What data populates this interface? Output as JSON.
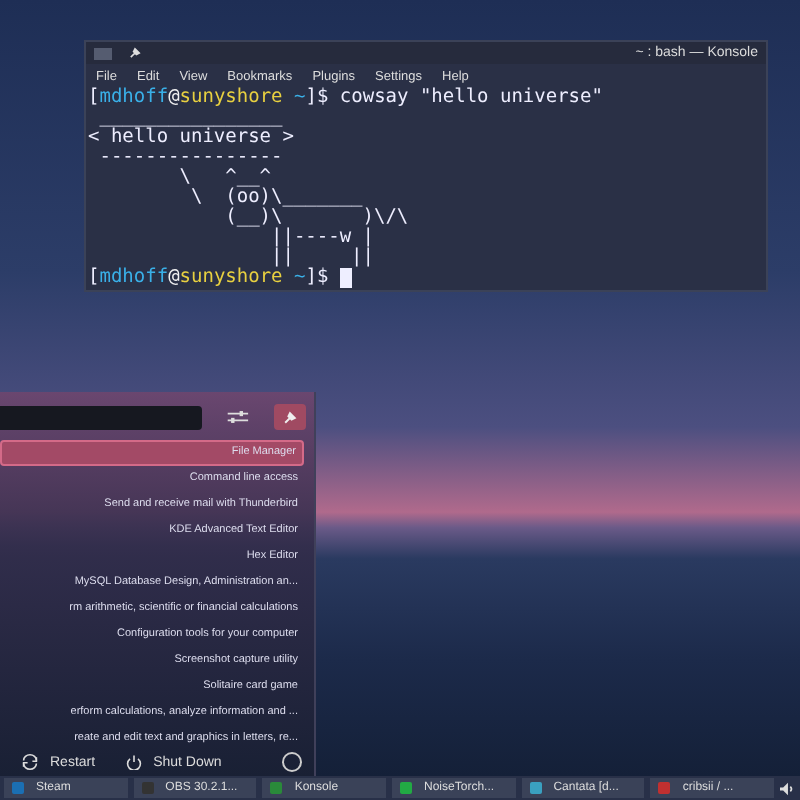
{
  "konsole": {
    "title": "~ : bash — Konsole",
    "menu": [
      "File",
      "Edit",
      "View",
      "Bookmarks",
      "Plugins",
      "Settings",
      "Help"
    ],
    "lines": [
      {
        "kind": "prompt",
        "open": "[",
        "user": "mdhoff",
        "at": "@",
        "host": "sunyshore",
        "dir": " ~",
        "close": "]$ ",
        "command": "cowsay \"hello universe\"",
        "cursor": false
      },
      {
        "kind": "output",
        "text": " ________________"
      },
      {
        "kind": "output",
        "text": "< hello universe >"
      },
      {
        "kind": "output",
        "text": " ----------------"
      },
      {
        "kind": "output",
        "text": "        \\   ^__^"
      },
      {
        "kind": "output",
        "text": "         \\  (oo)\\_______"
      },
      {
        "kind": "output",
        "text": "            (__)\\       )\\/\\"
      },
      {
        "kind": "output",
        "text": "                ||----w |"
      },
      {
        "kind": "output",
        "text": "                ||     ||"
      },
      {
        "kind": "prompt",
        "open": "[",
        "user": "mdhoff",
        "at": "@",
        "host": "sunyshore",
        "dir": " ~",
        "close": "]$ ",
        "cursor": true
      }
    ]
  },
  "launcher": {
    "items": [
      {
        "text": "File Manager",
        "selected": true
      },
      {
        "text": "Command line access",
        "selected": false
      },
      {
        "text": "Send and receive mail with Thunderbird",
        "selected": false
      },
      {
        "text": "KDE Advanced Text Editor",
        "selected": false
      },
      {
        "text": "Hex Editor",
        "selected": false
      },
      {
        "text": "MySQL Database Design, Administration an...",
        "selected": false
      },
      {
        "text": "rm arithmetic, scientific or financial calculations",
        "selected": false
      },
      {
        "text": "Configuration tools for your computer",
        "selected": false
      },
      {
        "text": "Screenshot capture utility",
        "selected": false
      },
      {
        "text": "Solitaire card game",
        "selected": false
      },
      {
        "text": "erform calculations, analyze information and ...",
        "selected": false
      },
      {
        "text": "reate and edit text and graphics in letters, re...",
        "selected": false
      }
    ],
    "actions": [
      {
        "kind": "restart",
        "label": "Restart"
      },
      {
        "kind": "shutdown",
        "label": "Shut Down"
      }
    ]
  },
  "taskbar": [
    {
      "kind": "steam",
      "label": "Steam"
    },
    {
      "kind": "obs",
      "label": "OBS 30.2.1..."
    },
    {
      "kind": "konsole",
      "label": "Konsole"
    },
    {
      "kind": "noise",
      "label": "NoiseTorch..."
    },
    {
      "kind": "cantata",
      "label": "Cantata [d..."
    },
    {
      "kind": "cribsii",
      "label": "cribsii / ..."
    }
  ]
}
